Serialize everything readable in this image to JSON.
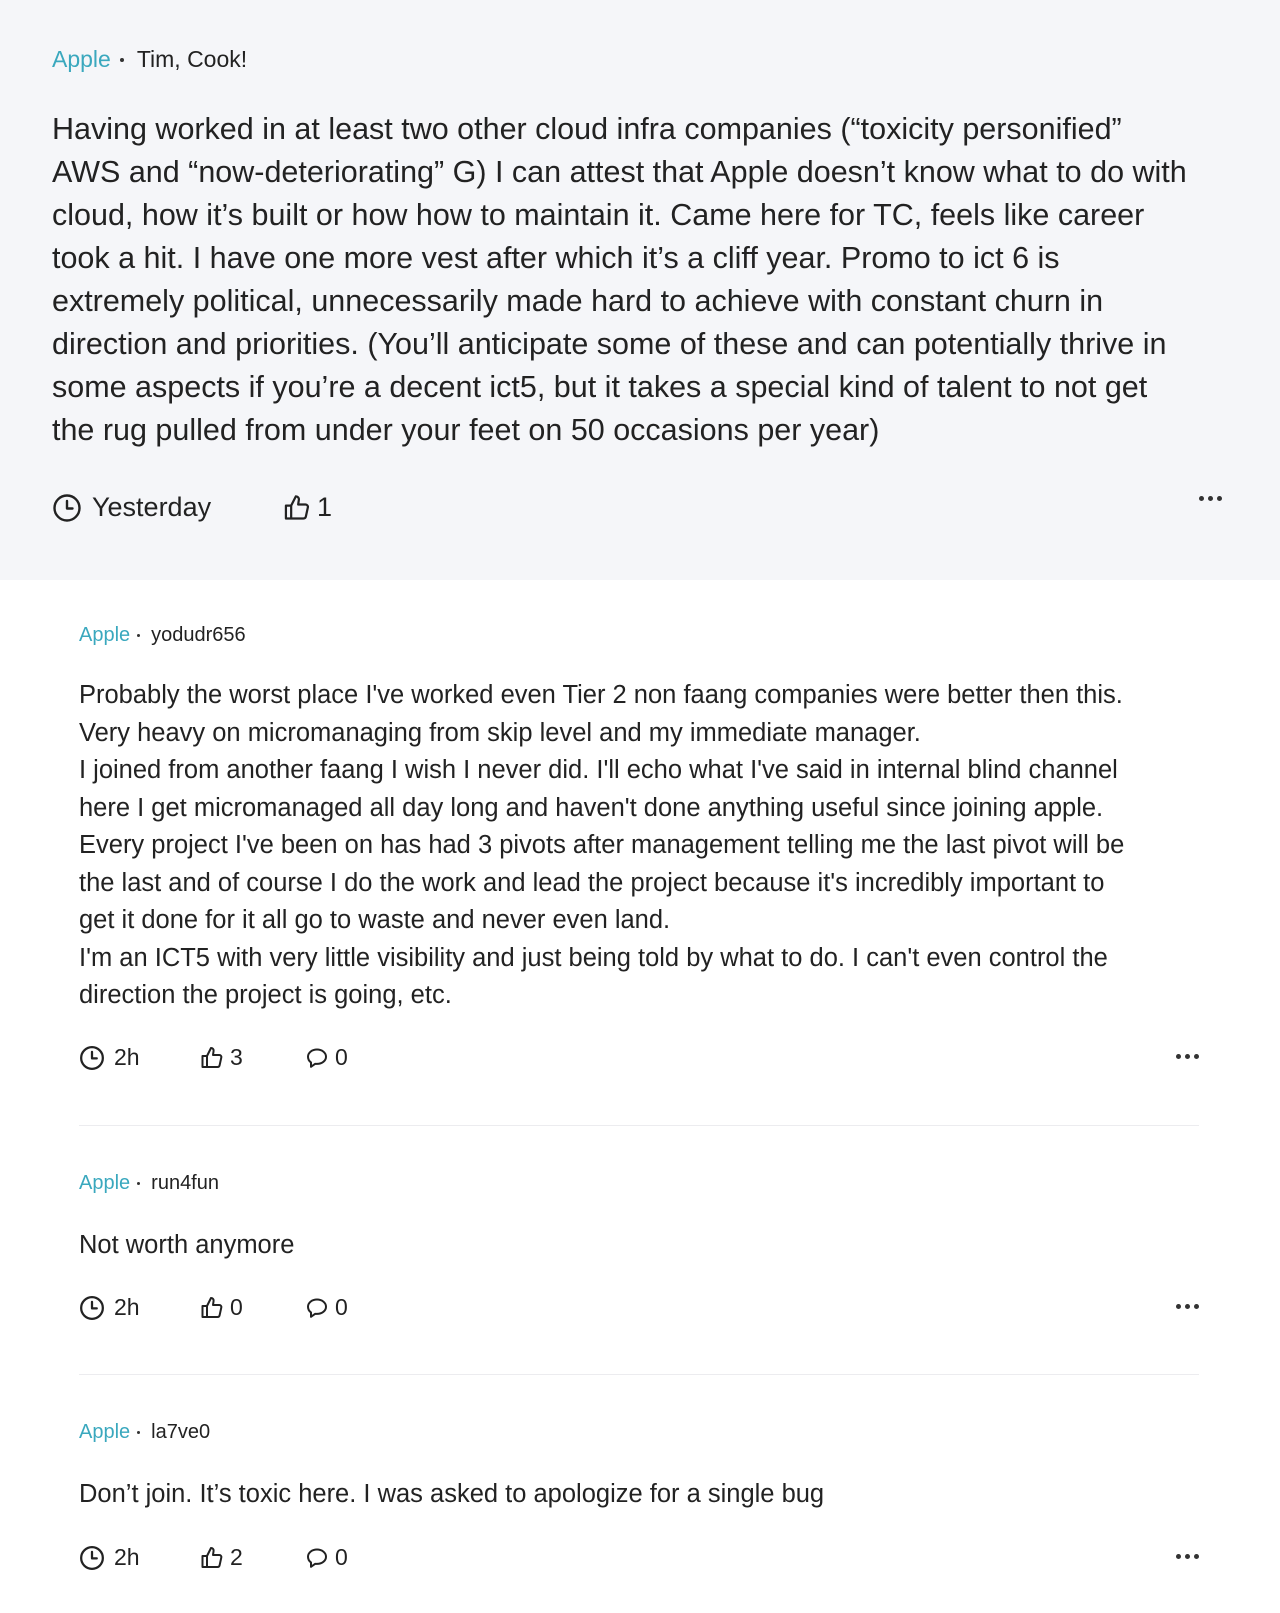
{
  "main_post": {
    "company": "Apple",
    "author": "Tim, Cook!",
    "body_lines": [
      "Having worked in at least two other cloud infra companies (“toxicity personified”",
      "AWS and “now-deteriorating” G) I can attest that Apple doesn’t know what to do with",
      "cloud, how it’s built or how how to maintain it. Came here for TC, feels like career",
      "took a hit. I have one more vest after which it’s a cliff year. Promo to ict 6 is",
      "extremely political, unnecessarily made hard to achieve with constant churn in",
      "direction and priorities. (You’ll anticipate some of these and can potentially thrive in",
      "some aspects if you’re a decent ict5, but it takes a special kind of talent to not get",
      "the rug pulled from under your feet on 50 occasions per year)"
    ],
    "time": "Yesterday",
    "likes": "1"
  },
  "comments": [
    {
      "company": "Apple",
      "author": "yodudr656",
      "body_lines": [
        "Probably the worst place I've worked even Tier 2 non faang companies were better then this.",
        "Very heavy on micromanaging from skip level and my immediate manager.",
        "I joined from another faang I wish I never did. I'll echo what I've said in internal blind channel",
        "here I get micromanaged all day long and haven't done anything useful since joining apple.",
        "Every project I've been on has had 3 pivots after management telling me the last pivot will be",
        "the last and of course I do the work and lead the project because it's incredibly important to",
        "get it done for it all go to waste and never even land.",
        "I'm an ICT5 with very little visibility and just being told by what to do. I can't even control the",
        "direction the project is going, etc."
      ],
      "time": "2h",
      "likes": "3",
      "replies": "0"
    },
    {
      "company": "Apple",
      "author": "run4fun",
      "body_lines": [
        "Not worth anymore"
      ],
      "time": "2h",
      "likes": "0",
      "replies": "0"
    },
    {
      "company": "Apple",
      "author": "la7ve0",
      "body_lines": [
        "Don’t join. It’s toxic here. I was asked to apologize for a single bug"
      ],
      "time": "2h",
      "likes": "2",
      "replies": "0"
    }
  ],
  "icons": {
    "time": "clock-icon",
    "likes": "thumbs-up-icon",
    "replies": "comment-bubble-icon",
    "more": "more-options-icon"
  },
  "colors": {
    "company": "#3aa8be",
    "main_post_background": "#f5f6f9",
    "text": "#222222"
  }
}
